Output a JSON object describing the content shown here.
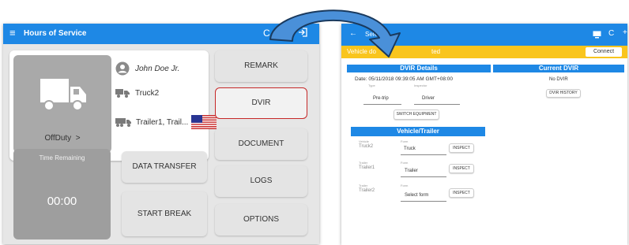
{
  "left_screen": {
    "app_bar": {
      "menu_icon": "hamburger-icon",
      "title": "Hours of Service",
      "sync_icon": "refresh-icon",
      "logout_icon": "logout-icon"
    },
    "driver": {
      "name": "John Doe Jr.",
      "truck": "Truck2",
      "trailer": "Trailer1, Trail...",
      "flag": "us-flag"
    },
    "status": {
      "label": "OffDuty",
      "chevron": ">"
    },
    "time_remaining": {
      "label": "Time Remaining",
      "value": "00:00"
    },
    "buttons": {
      "remark": "REMARK",
      "dvir": "DVIR",
      "document": "DOCUMENT",
      "data_transfer": "DATA TRANSFER",
      "logs": "LOGS",
      "start_break": "START BREAK",
      "options": "OPTIONS"
    }
  },
  "right_screen": {
    "app_bar": {
      "back_icon": "back-arrow-icon",
      "title": "Sele",
      "device_icon": "monitor-icon",
      "refresh_icon": "refresh-icon"
    },
    "banner": {
      "text": "Vehicle do",
      "text2": "ted",
      "connect": "Connect"
    },
    "dvir_details": {
      "header": "DVIR Details",
      "date": "Date: 05/11/2018 09:39:05 AM GMT+08:00",
      "type_label": "Type",
      "inspector_label": "Inspector",
      "type_value": "Pre-trip",
      "inspector_value": "Driver",
      "switch_button": "SWITCH EQUIPMENT"
    },
    "current_dvir": {
      "header": "Current DVIR",
      "text": "No DVIR",
      "history_button": "DVIR HISTORY"
    },
    "vehicle_trailer": {
      "header": "Vehicle/Trailer",
      "rows": [
        {
          "kind": "Vehicle",
          "name": "Truck2",
          "form_label": "Form",
          "form": "Truck",
          "inspect": "INSPECT"
        },
        {
          "kind": "Trailer",
          "name": "Trailer1",
          "form_label": "Form",
          "form": "Trailer",
          "inspect": "INSPECT"
        },
        {
          "kind": "Trailer",
          "name": "Trailer2",
          "form_label": "Form",
          "form": "Select form",
          "inspect": "INSPECT"
        }
      ]
    }
  },
  "annotation": {
    "arrow_color": "#4a90d9",
    "outline_color": "#1a3a5e",
    "highlight_color": "#c62828"
  }
}
